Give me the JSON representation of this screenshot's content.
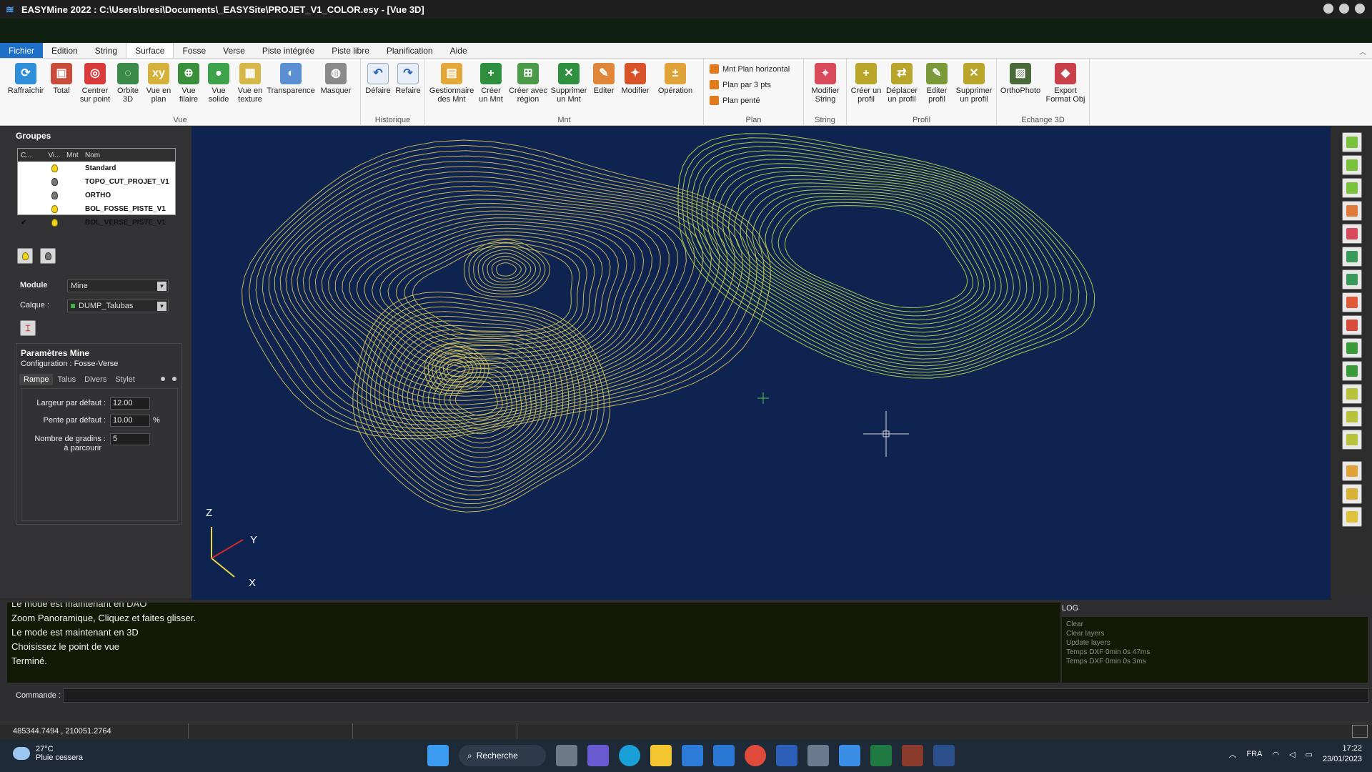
{
  "window": {
    "title": "EASYMine 2022 : C:\\Users\\bresi\\Documents\\_EASYSite\\PROJET_V1_COLOR.esy - [Vue 3D]"
  },
  "menu": {
    "tabs": [
      "Fichier",
      "Edition",
      "String",
      "Surface",
      "Fosse",
      "Verse",
      "Piste intégrée",
      "Piste libre",
      "Planification",
      "Aide"
    ],
    "active": "Surface"
  },
  "ribbon": {
    "vue": {
      "label": "Vue",
      "buttons": [
        "Raffraîchir",
        "Total",
        "Centrer sur point",
        "Orbite 3D",
        "Vue en plan",
        "Vue filaire",
        "Vue solide",
        "Vue en texture",
        "Transparence",
        "Masquer"
      ]
    },
    "historique": {
      "label": "Historique",
      "buttons": [
        "Défaire",
        "Refaire"
      ]
    },
    "mnt": {
      "label": "Mnt",
      "buttons": [
        "Gestionnaire des Mnt",
        "Créer un Mnt",
        "Créer avec région",
        "Supprimer un Mnt",
        "Editer",
        "Modifier",
        "Opération"
      ]
    },
    "plan": {
      "label": "Plan",
      "items": [
        "Mnt Plan horizontal",
        "Plan par 3 pts",
        "Plan penté"
      ]
    },
    "string": {
      "label": "String",
      "buttons": [
        "Modifier String"
      ]
    },
    "profil": {
      "label": "Profil",
      "buttons": [
        "Créer un profil",
        "Déplacer un profil",
        "Editer profil",
        "Supprimer un profil"
      ]
    },
    "echange": {
      "label": "Echange 3D",
      "buttons": [
        "OrthoPhoto",
        "Export Format Obj"
      ]
    }
  },
  "groups": {
    "title": "Groupes",
    "columns": [
      "C...",
      "Vi...",
      "Mnt",
      "Nom"
    ],
    "rows": [
      {
        "name": "Standard",
        "visible": true,
        "checked": false
      },
      {
        "name": "TOPO_CUT_PROJET_V1",
        "visible": false,
        "checked": false
      },
      {
        "name": "ORTHO",
        "visible": false,
        "checked": false
      },
      {
        "name": "BOL_FOSSE_PISTE_V1",
        "visible": true,
        "checked": false
      },
      {
        "name": "BOL_VERSE_PISTE_V1",
        "visible": true,
        "checked": true
      }
    ]
  },
  "module": {
    "label": "Module",
    "value": "Mine",
    "calque_label": "Calque :",
    "calque_value": "DUMP_Talubas"
  },
  "params": {
    "title": "Paramètres Mine",
    "config": "Configuration : Fosse-Verse",
    "tabs": [
      "Rampe",
      "Talus",
      "Divers",
      "Stylet"
    ],
    "active_tab": "Rampe",
    "largeur_label": "Largeur par défaut :",
    "largeur_value": "12.00",
    "pente_label": "Pente par défaut :",
    "pente_value": "10.00",
    "pente_unit": "%",
    "gradins_label_1": "Nombre de gradins :",
    "gradins_label_2": "à parcourir",
    "gradins_value": "5"
  },
  "axes": {
    "z": "Z",
    "y": "Y",
    "x": "X"
  },
  "console": {
    "lines": [
      "Le mode est maintenant en DAO",
      "Zoom Panoramique, Cliquez et faites glisser.",
      "Le mode est maintenant en 3D",
      "Choisissez le point de vue",
      "Terminé."
    ],
    "log_title": "LOG",
    "log_lines": [
      "Clear",
      "Clear layers",
      "Update layers",
      "Temps DXF 0min 0s 47ms",
      "Temps DXF 0min 0s 3ms"
    ],
    "command_label": "Commande :"
  },
  "status": {
    "coords": "485344.7494 , 210051.2764"
  },
  "taskbar": {
    "weather_temp": "27°C",
    "weather_desc": "Pluie cessera",
    "search": "Recherche",
    "lang": "FRA",
    "time": "17:22",
    "date": "23/01/2023"
  },
  "colors": {
    "viewport_bg": "#0e2350",
    "contour_yellow": "#d8c75a",
    "contour_green": "#b8e04a",
    "accent_blue": "#1e6fc8"
  }
}
